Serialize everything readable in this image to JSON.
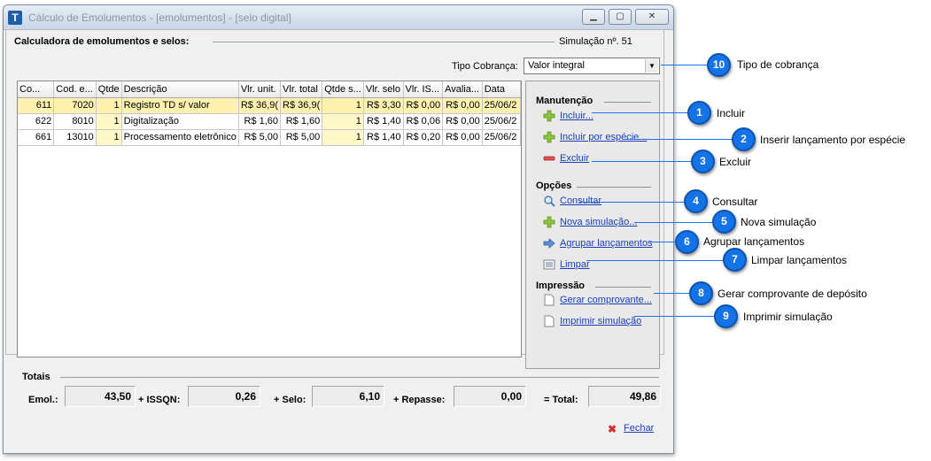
{
  "window": {
    "title": "Cálculo de Emolumentos - [emolumentos] - [selo digital]",
    "app_icon": "T",
    "min_glyph": "▁",
    "max_glyph": "▢",
    "close_glyph": "✕"
  },
  "header": {
    "calc_title": "Calculadora de emolumentos e selos:",
    "simulation": "Simulação nº. 51"
  },
  "tipo_cobranca": {
    "label": "Tipo Cobrança:",
    "value": "Valor integral"
  },
  "grid": {
    "columns": [
      "Co...",
      "Cod. e...",
      "Qtde",
      "Descrição",
      "Vlr. unit.",
      "Vlr. total",
      "Qtde s...",
      "Vlr. selo",
      "Vlr. IS...",
      "Avalia...",
      "Data"
    ],
    "rows": [
      [
        "611",
        "7020",
        "1",
        "Registro TD s/ valor",
        "R$ 36,9(",
        "R$ 36,9(",
        "1",
        "R$ 3,30",
        "R$ 0,00",
        "R$ 0,00",
        "25/06/2"
      ],
      [
        "622",
        "8010",
        "1",
        "Digitalização",
        "R$ 1,60",
        "R$ 1,60",
        "1",
        "R$ 1,40",
        "R$ 0,06",
        "R$ 0,00",
        "25/06/2"
      ],
      [
        "661",
        "13010",
        "1",
        "Processamento eletrônico",
        "R$ 5,00",
        "R$ 5,00",
        "1",
        "R$ 1,40",
        "R$ 0,20",
        "R$ 0,00",
        "25/06/2"
      ]
    ]
  },
  "side": {
    "manutencao": "Manutenção",
    "incluir": "Incluir...",
    "incluir_especie": "Incluir por espécie...",
    "excluir": "Excluir",
    "opcoes": "Opções",
    "consultar": "Consultar",
    "nova_simulacao": "Nova simulação...",
    "agrupar": "Agrupar lançamentos",
    "limpar": "Limpar",
    "impressao": "Impressão",
    "gerar": "Gerar comprovante...",
    "imprimir": "Imprimir simulação"
  },
  "totais": {
    "title": "Totais",
    "emol_label": "Emol.:",
    "emol": "43,50",
    "issqn_label": "+ ISSQN:",
    "issqn": "0,26",
    "selo_label": "+ Selo:",
    "selo": "6,10",
    "repasse_label": "+ Repasse:",
    "repasse": "0,00",
    "total_label": "= Total:",
    "total": "49,86"
  },
  "footer": {
    "fechar": "Fechar",
    "fechar_glyph": "✖"
  },
  "callouts": [
    {
      "n": "10",
      "label": "Tipo de cobrança"
    },
    {
      "n": "1",
      "label": "Incluir"
    },
    {
      "n": "2",
      "label": "Inserir lançamento por espécie"
    },
    {
      "n": "3",
      "label": "Excluir"
    },
    {
      "n": "4",
      "label": "Consultar"
    },
    {
      "n": "5",
      "label": "Nova simulação"
    },
    {
      "n": "6",
      "label": "Agrupar lançamentos"
    },
    {
      "n": "7",
      "label": "Limpar lançamentos"
    },
    {
      "n": "8",
      "label": "Gerar comprovante de depósito"
    },
    {
      "n": "9",
      "label": "Imprimir simulação"
    }
  ],
  "colors": {
    "callout": "#1473e6",
    "link": "#1a3fb8",
    "row_highlight": "#fef7c8"
  }
}
